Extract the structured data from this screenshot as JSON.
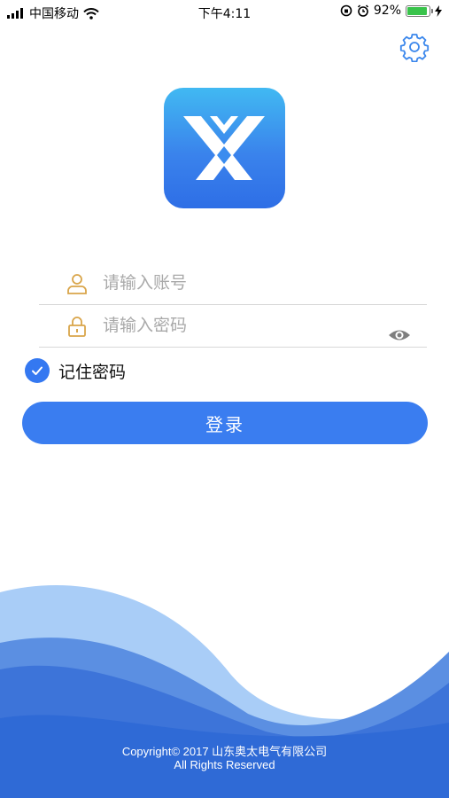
{
  "status_bar": {
    "carrier": "中国移动",
    "time": "下午4:11",
    "battery_percent": "92%",
    "battery_level": 0.92,
    "icons": [
      "signal-bars-icon",
      "wifi-icon",
      "orientation-lock-icon",
      "alarm-icon",
      "battery-icon",
      "charging-bolt-icon"
    ]
  },
  "header": {
    "settings_icon": "gear-icon"
  },
  "logo": {
    "icon": "app-logo"
  },
  "form": {
    "account_placeholder": "请输入账号",
    "password_placeholder": "请输入密码",
    "account_icon": "user-icon",
    "password_icon": "lock-icon",
    "password_toggle_icon": "eye-icon",
    "remember_label": "记住密码",
    "remember_checked": true,
    "login_label": "登录"
  },
  "footer": {
    "copyright_line1": "Copyright© 2017 山东奥太电气有限公司",
    "copyright_line2": "All Rights Reserved"
  },
  "colors": {
    "primary": "#3a7df0",
    "icon_gold": "#d9a54a",
    "check_blue": "#3478f1",
    "wave_light": "#a9cdf7",
    "wave_dark": "#2e63d0"
  }
}
